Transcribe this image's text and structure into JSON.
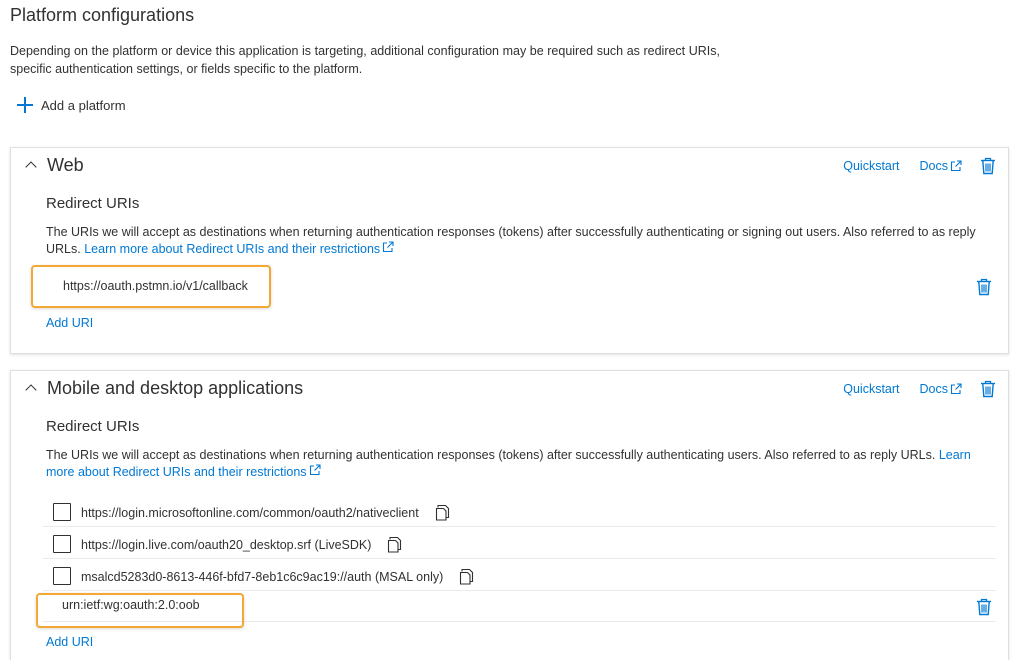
{
  "page": {
    "title": "Platform configurations",
    "intro": "Depending on the platform or device this application is targeting, additional configuration may be required such as redirect URIs, specific authentication settings, or fields specific to the platform.",
    "add_platform_label": "Add a platform"
  },
  "web": {
    "title": "Web",
    "quickstart_label": "Quickstart",
    "docs_label": "Docs",
    "redirect_title": "Redirect URIs",
    "redirect_desc": "The URIs we will accept as destinations when returning authentication responses (tokens) after successfully authenticating or signing out users. Also referred to as reply URLs.",
    "learn_more_label": "Learn more about Redirect URIs and their restrictions",
    "uri_value": "https://oauth.pstmn.io/v1/callback",
    "add_uri_label": "Add URI"
  },
  "mobile": {
    "title": "Mobile and desktop applications",
    "quickstart_label": "Quickstart",
    "docs_label": "Docs",
    "redirect_title": "Redirect URIs",
    "redirect_desc": "The URIs we will accept as destinations when returning authentication responses (tokens) after successfully authenticating users. Also referred to as reply URLs.",
    "learn_more_label": "Learn more about Redirect URIs and their restrictions",
    "suggested_uris": [
      {
        "label": "https://login.microsoftonline.com/common/oauth2/nativeclient",
        "checked": false
      },
      {
        "label": "https://login.live.com/oauth20_desktop.srf (LiveSDK)",
        "checked": false
      },
      {
        "label": "msalcd5283d0-8613-446f-bfd7-8eb1c6c9ac19://auth (MSAL only)",
        "checked": false
      }
    ],
    "custom_uri_value": "urn:ietf:wg:oauth:2.0:oob",
    "add_uri_label": "Add URI"
  },
  "colors": {
    "accent": "#0078d4",
    "highlight": "#f2a832",
    "text": "#323130",
    "border": "#e1dfdd"
  },
  "icons": [
    "plus-icon",
    "chevron-up-icon",
    "external-link-icon",
    "trash-icon",
    "copy-icon",
    "checkbox"
  ]
}
